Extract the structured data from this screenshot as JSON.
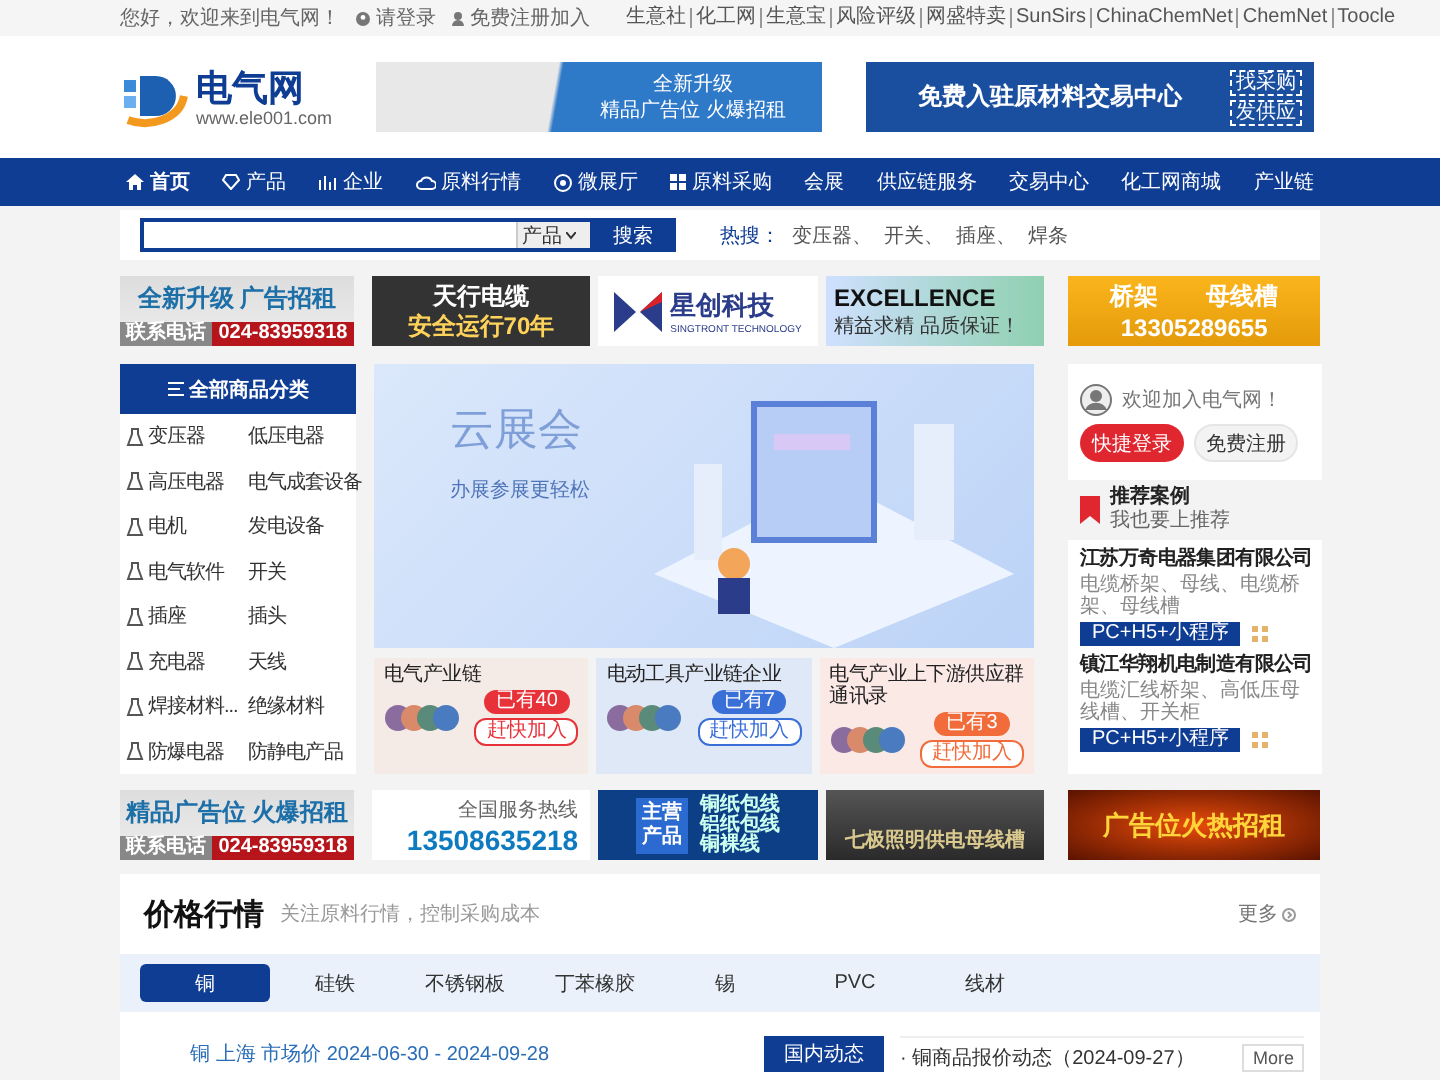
{
  "top_bar": {
    "greeting": "您好，欢迎来到电气网！",
    "login": "请登录",
    "register": "免费注册加入",
    "links": [
      "生意社",
      "化工网",
      "生意宝",
      "风险评级",
      "网盛特卖",
      "SunSirs",
      "ChinaChemNet",
      "ChemNet",
      "Toocle"
    ]
  },
  "header": {
    "logo_name": "电气网",
    "logo_url": "www.ele001.com",
    "banner_1": [
      "全新升级",
      "精品广告位 火爆招租"
    ],
    "banner_2": {
      "title": "免费入驻原材料交易中心",
      "tags": [
        "找采购",
        "发供应"
      ]
    }
  },
  "nav": [
    {
      "label": "首页",
      "selected": true
    },
    {
      "label": "产品",
      "selected": false
    },
    {
      "label": "企业",
      "selected": false
    },
    {
      "label": "原料行情",
      "selected": false
    },
    {
      "label": "微展厅",
      "selected": false
    },
    {
      "label": "原料采购",
      "selected": false
    },
    {
      "label": "会展",
      "selected": false
    },
    {
      "label": "供应链服务",
      "selected": false
    },
    {
      "label": "交易中心",
      "selected": false
    },
    {
      "label": "化工网商城",
      "selected": false
    },
    {
      "label": "产业链",
      "selected": false
    }
  ],
  "search": {
    "category": "产品",
    "button": "搜索",
    "hot_label": "热搜：",
    "hot": [
      "变压器、",
      "开关、",
      "插座、",
      "焊条"
    ]
  },
  "ads_top": [
    {
      "kind": "rent",
      "lines": [
        "全新升级  广告招租",
        "联系电话",
        "024-83959318"
      ]
    },
    {
      "kind": "cable",
      "lines": [
        "天行电缆",
        "安全运行70年"
      ]
    },
    {
      "kind": "brand",
      "lines": [
        "星创科技",
        "SINGTRONT TECHNOLOGY"
      ]
    },
    {
      "kind": "excellence",
      "lines": [
        "EXCELLENCE",
        "精益求精 品质保证！"
      ]
    },
    {
      "kind": "gold",
      "lines": [
        "桥架　　母线槽",
        "13305289655"
      ]
    }
  ],
  "categories": {
    "title": "全部商品分类",
    "rows": [
      [
        "变压器",
        "低压电器"
      ],
      [
        "高压电器",
        "电气成套设备"
      ],
      [
        "电机",
        "发电设备"
      ],
      [
        "电气软件",
        "开关"
      ],
      [
        "插座",
        "插头"
      ],
      [
        "充电器",
        "天线"
      ],
      [
        "焊接材料...",
        "绝缘材料"
      ],
      [
        "防爆电器",
        "防静电产品"
      ]
    ]
  },
  "carousel": {
    "title": "云展会",
    "subtitle": "办展参展更轻松"
  },
  "groups": [
    {
      "title": "电气产业链",
      "count": "已有40",
      "join": "赶快加入",
      "color": "#e8323a",
      "kind": "warm"
    },
    {
      "title": "电动工具产业链企业",
      "count": "已有7",
      "join": "赶快加入",
      "color": "#3a6fd8",
      "kind": "cool"
    },
    {
      "title": "电气产业上下游供应群通讯录",
      "count": "已有3",
      "join": "赶快加入",
      "color": "#f26b3a",
      "kind": "pink"
    }
  ],
  "member": {
    "welcome": "欢迎加入电气网！",
    "login": "快捷登录",
    "register": "免费注册"
  },
  "recommend": {
    "title": "推荐案例",
    "subtitle": "我也要上推荐",
    "companies": [
      {
        "name": "江苏万奇电器集团有限公司",
        "desc": "电缆桥架、母线、电缆桥架、母线槽",
        "tag": "PC+H5+小程序"
      },
      {
        "name": "镇江华翔机电制造有限公司",
        "desc": "电缆汇线桥架、高低压母线槽、开关柜",
        "tag": "PC+H5+小程序"
      }
    ]
  },
  "ads_bottom": [
    {
      "kind": "rent",
      "lines": [
        "精品广告位  火爆招租",
        "联系电话",
        "024-83959318"
      ]
    },
    {
      "kind": "hotline",
      "lines": [
        "全国服务热线",
        "13508635218"
      ]
    },
    {
      "kind": "product",
      "lines": [
        "主营产品",
        "铜纸包线",
        "铝纸包线",
        "铜裸线"
      ]
    },
    {
      "kind": "photo",
      "lines": [
        "七极照明供电母线槽"
      ]
    },
    {
      "kind": "fire",
      "lines": [
        "广告位火热招租"
      ]
    }
  ],
  "prices": {
    "title": "价格行情",
    "subtitle": "关注原料行情，控制采购成本",
    "more": "更多",
    "tabs": [
      {
        "label": "铜",
        "selected": true
      },
      {
        "label": "硅铁",
        "selected": false
      },
      {
        "label": "不锈钢板",
        "selected": false
      },
      {
        "label": "丁苯橡胶",
        "selected": false
      },
      {
        "label": "锡",
        "selected": false
      },
      {
        "label": "PVC",
        "selected": false
      },
      {
        "label": "线材",
        "selected": false
      }
    ],
    "chart_caption": "铜 上海 市场价 2024-06-30 - 2024-09-28",
    "news_tab": "国内动态",
    "news": [
      {
        "title": "· 铜商品报价动态（2024-09-27）",
        "action": "More"
      }
    ]
  }
}
